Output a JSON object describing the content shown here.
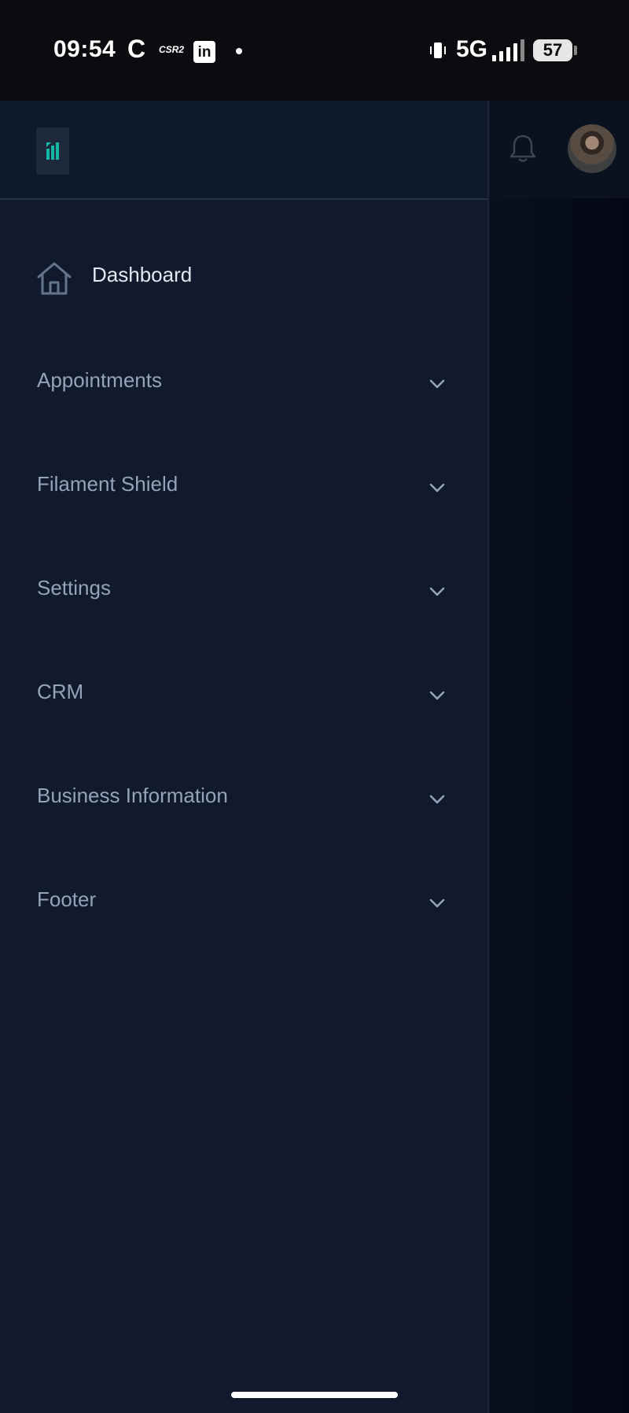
{
  "status_bar": {
    "time": "09:54",
    "notif_c": "C",
    "notif_csr": "CSR2",
    "notif_linkedin": "in",
    "network": "5G",
    "battery": "57"
  },
  "topbar": {
    "icons": [
      "bell-icon",
      "avatar"
    ]
  },
  "sidebar": {
    "logo_icon": "brand-logo-icon",
    "items": [
      {
        "label": "Dashboard",
        "icon": "home-icon",
        "active": true
      },
      {
        "label": "Appointments",
        "icon": "chevron-down-icon"
      },
      {
        "label": "Filament Shield",
        "icon": "chevron-down-icon"
      },
      {
        "label": "Settings",
        "icon": "chevron-down-icon"
      },
      {
        "label": "CRM",
        "icon": "chevron-down-icon"
      },
      {
        "label": "Business Information",
        "icon": "chevron-down-icon"
      },
      {
        "label": "Footer",
        "icon": "chevron-down-icon"
      }
    ]
  },
  "colors": {
    "sidebar_bg": "#111a2d",
    "label": "#94a3b8",
    "active_label": "#e2e8f0",
    "logo_accent": "#14b8a6"
  }
}
